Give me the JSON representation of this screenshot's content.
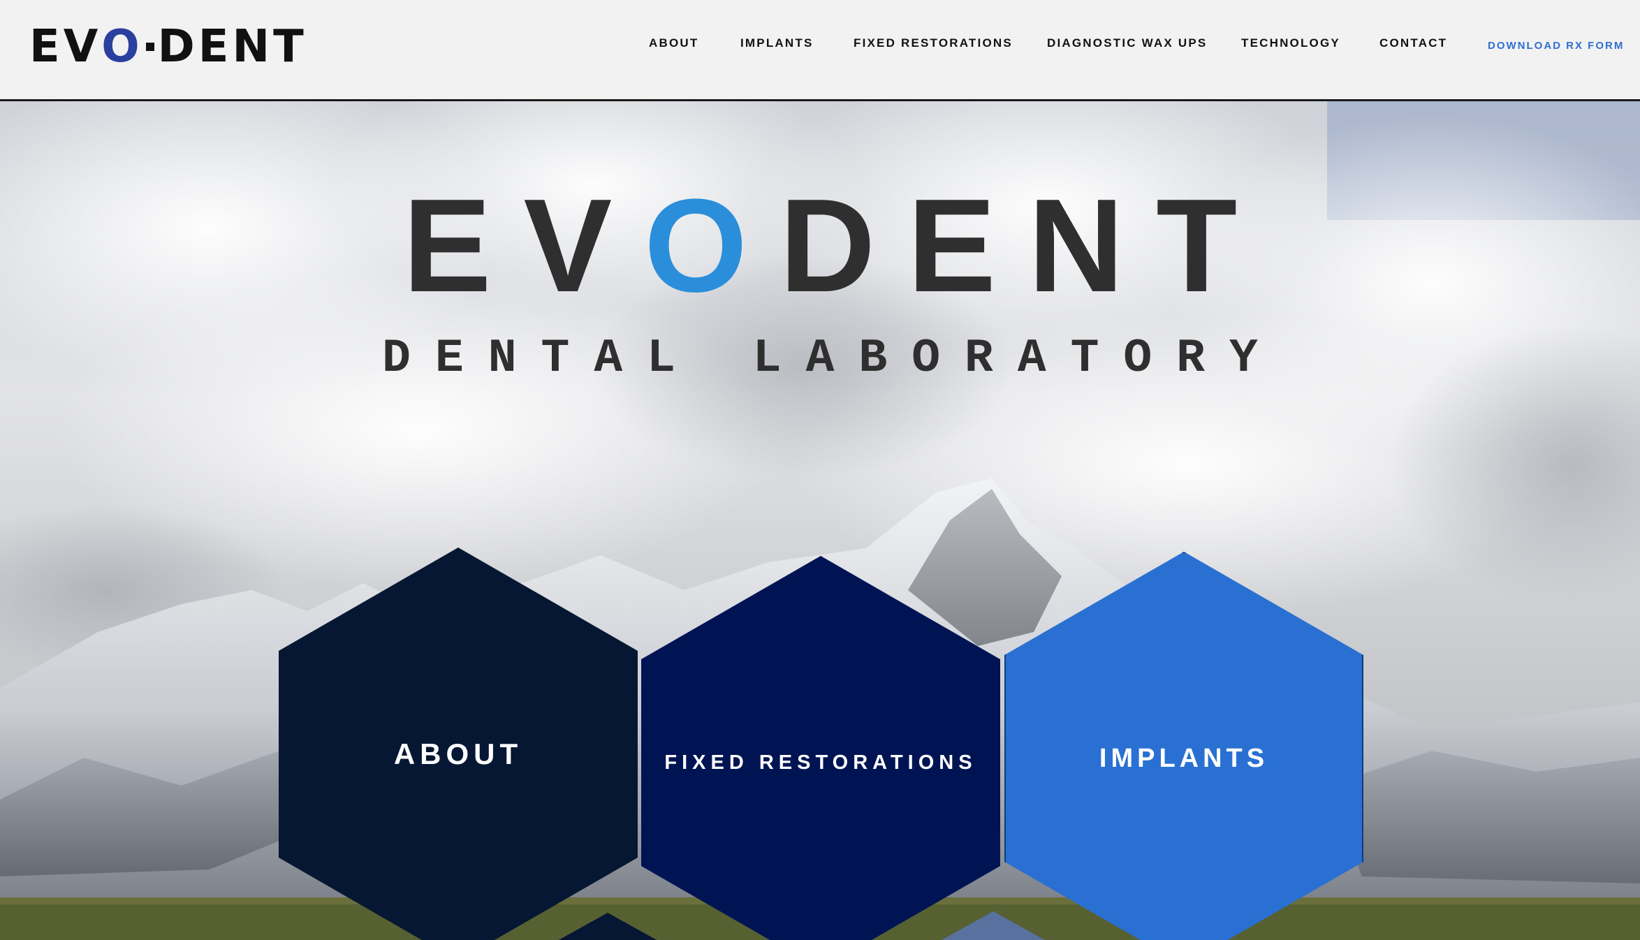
{
  "header": {
    "logo": {
      "part1": "EV",
      "accent": "O",
      "part2": "DENT"
    },
    "nav": [
      {
        "label": "ABOUT"
      },
      {
        "label": "IMPLANTS"
      },
      {
        "label": "FIXED RESTORATIONS"
      },
      {
        "label": "DIAGNOSTIC WAX UPS"
      },
      {
        "label": "TECHNOLOGY"
      },
      {
        "label": "CONTACT"
      }
    ],
    "cta_label": "DOWNLOAD RX FORM"
  },
  "hero": {
    "title_part1": "EV",
    "title_accent": "O",
    "title_part2": "DENT",
    "subtitle": "DENTAL LABORATORY",
    "background": "cloudy-sky-over-snowy-mountains",
    "tiles": [
      {
        "label": "ABOUT",
        "color": "#061733"
      },
      {
        "label": "FIXED RESTORATIONS",
        "color": "#001454"
      },
      {
        "label": "IMPLANTS",
        "color": "#2a70d2"
      }
    ]
  },
  "colors": {
    "header_bg": "#f2f2f2",
    "logo_accent": "#2a3f9e",
    "title_accent": "#2a8edb",
    "cta": "#2f6fd0",
    "text_dark": "#2f2f2f"
  }
}
